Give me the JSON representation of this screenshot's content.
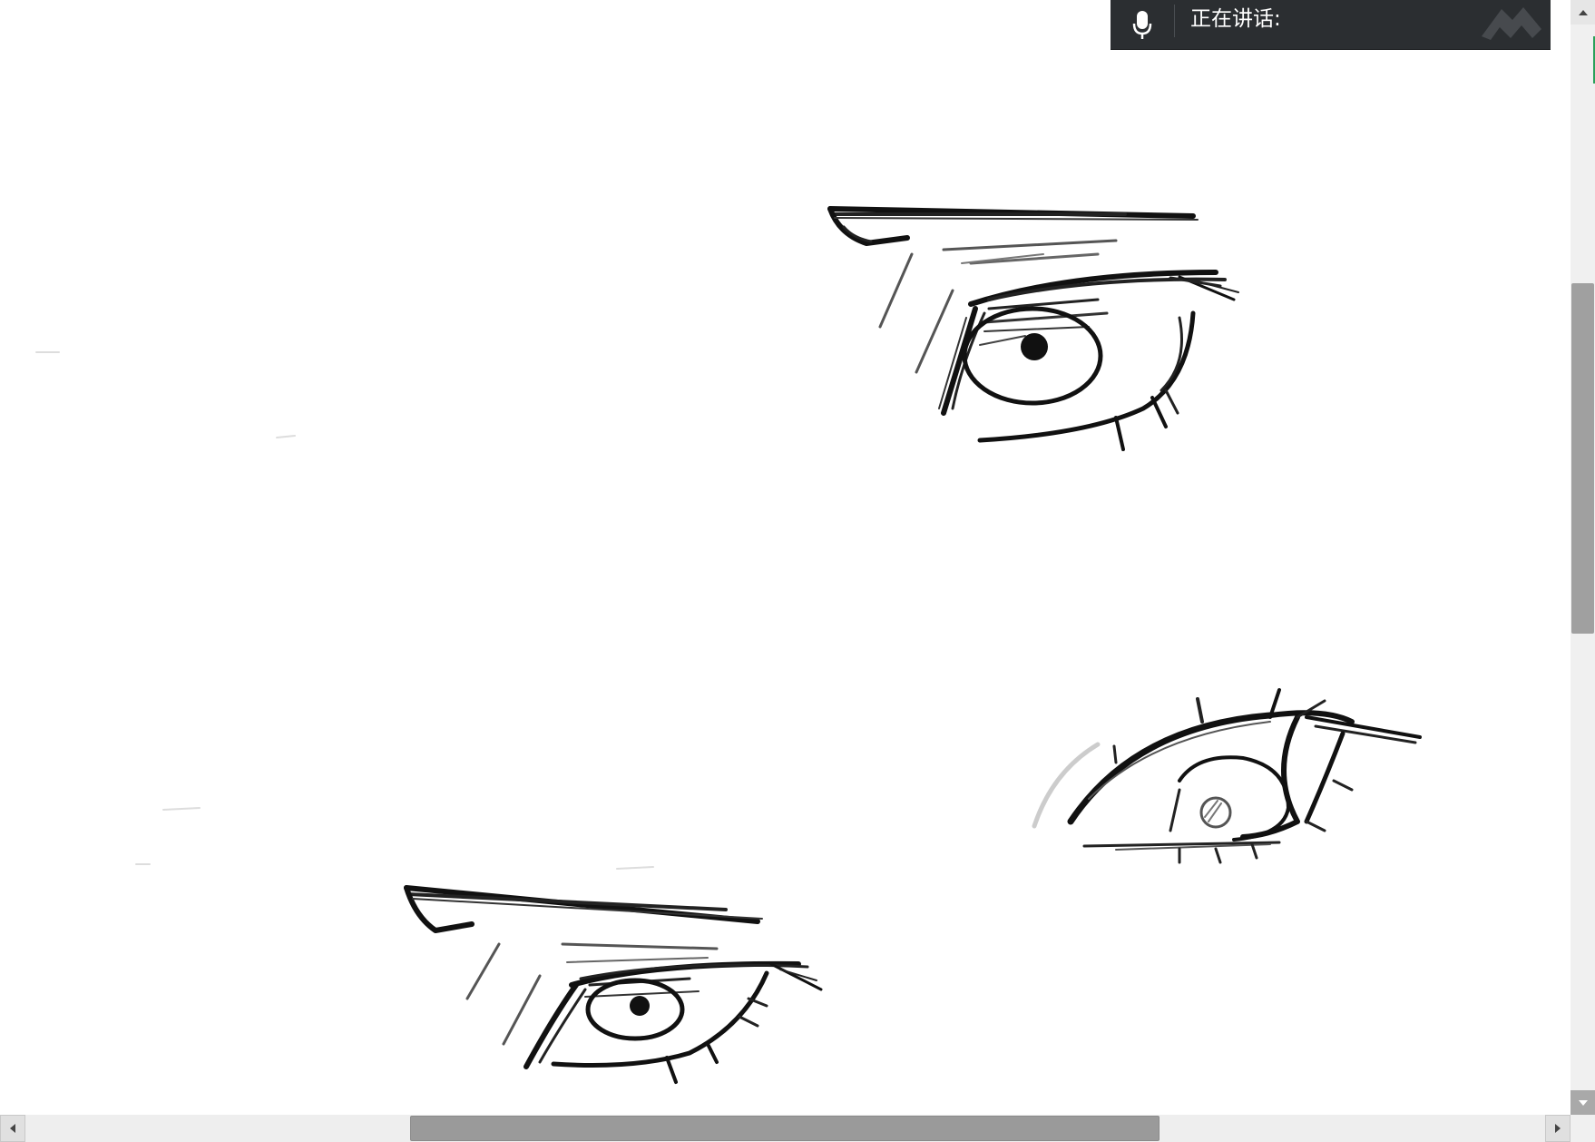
{
  "voice_bar": {
    "status_label": "正在讲话:",
    "mic_icon": "microphone-icon",
    "logo_icon": "app-logo-icon"
  },
  "canvas": {
    "drawings": [
      "eye-sketch-upper",
      "eye-sketch-right",
      "eye-sketch-lower"
    ]
  },
  "scrollbars": {
    "vertical": {
      "up_icon": "arrow-up-icon",
      "down_icon": "arrow-down-icon"
    },
    "horizontal": {
      "left_icon": "arrow-left-icon",
      "right_icon": "arrow-right-icon"
    }
  },
  "colors": {
    "voice_bar_bg": "#2b2e31",
    "ink": "#111111",
    "scroll_thumb": "#9a9a9a",
    "accent_green": "#2aa05a"
  }
}
